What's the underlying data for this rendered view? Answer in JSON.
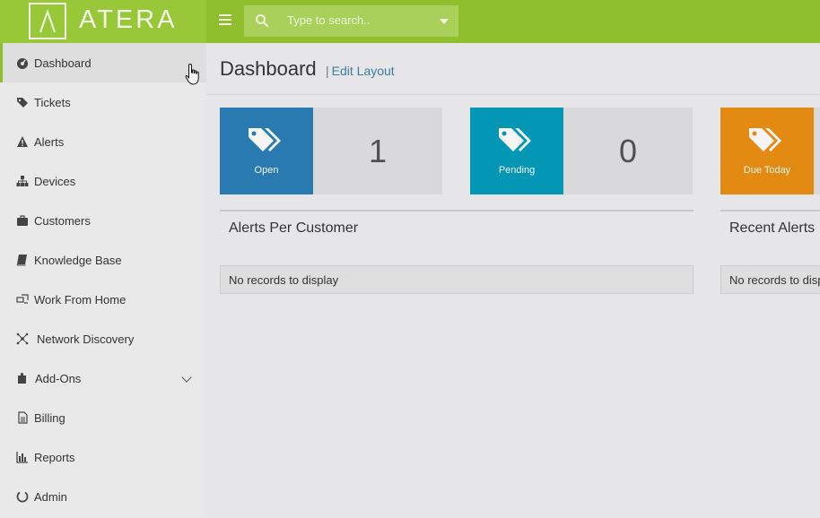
{
  "app": {
    "logo_text": "ATERA"
  },
  "search": {
    "placeholder": "Type to search.."
  },
  "sidebar": {
    "items": [
      {
        "label": "Dashboard",
        "icon": "dashboard-icon"
      },
      {
        "label": "Tickets",
        "icon": "tags-icon"
      },
      {
        "label": "Alerts",
        "icon": "warning-icon"
      },
      {
        "label": "Devices",
        "icon": "sitemap-icon"
      },
      {
        "label": "Customers",
        "icon": "briefcase-icon"
      },
      {
        "label": "Knowledge Base",
        "icon": "book-icon"
      },
      {
        "label": "Work From Home",
        "icon": "remote-icon"
      },
      {
        "label": "Network Discovery",
        "icon": "network-icon"
      },
      {
        "label": "Add-Ons",
        "icon": "puzzle-icon"
      },
      {
        "label": "Billing",
        "icon": "file-icon"
      },
      {
        "label": "Reports",
        "icon": "bar-chart-icon"
      },
      {
        "label": "Admin",
        "icon": "circle-notch-icon"
      }
    ]
  },
  "header": {
    "title": "Dashboard",
    "edit_layout": "Edit Layout",
    "separator": "|"
  },
  "tiles": [
    {
      "label": "Open",
      "count": "1",
      "color": "#2a7ab2"
    },
    {
      "label": "Pending",
      "count": "0",
      "color": "#0497b5"
    },
    {
      "label": "Due Today",
      "count": "",
      "color": "#e28a12"
    }
  ],
  "panels": [
    {
      "title": "Alerts Per Customer",
      "empty_text": "No records to display"
    },
    {
      "title": "Recent Alerts",
      "empty_text": "No records to display"
    }
  ],
  "colors": {
    "brand_green": "#8fbf2d",
    "link": "#3d7ca0"
  }
}
